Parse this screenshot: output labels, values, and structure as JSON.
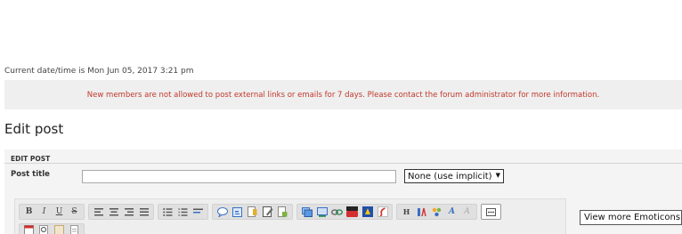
{
  "header": {
    "datetime": "Current date/time is Mon Jun 05, 2017 3:21 pm",
    "notice": "New members are not allowed to post external links or emails for 7 days. Please contact the forum administrator for more information."
  },
  "page": {
    "title": "Edit post"
  },
  "panel": {
    "heading": "EDIT POST",
    "post_title_label": "Post title",
    "post_title_value": "",
    "icon_select": {
      "selected": "None (use implicit)"
    }
  },
  "editor": {
    "row1_groups": [
      [
        "bold-icon",
        "italic-icon",
        "underline-icon",
        "strikethrough-icon"
      ],
      [
        "align-left-icon",
        "align-center-icon",
        "align-right-icon",
        "justify-icon"
      ],
      [
        "bullet-list-icon",
        "numbered-list-icon",
        "horizontal-rule-icon"
      ],
      [
        "quote-icon",
        "code-icon",
        "spoiler-icon",
        "hide-icon",
        "table-icon"
      ],
      [
        "image-icon",
        "image-host-icon",
        "link-icon",
        "youtube-icon",
        "dailymotion-icon",
        "flash-icon"
      ],
      [
        "heading-icon",
        "font-family-icon",
        "color-icon",
        "font-size-icon",
        "more-format-icon"
      ],
      [
        "more-icon"
      ]
    ],
    "row2_icons": [
      "date-icon",
      "search-icon",
      "gif-icon",
      "page-icon"
    ]
  },
  "emoticons": {
    "label": "View more Emoticons"
  },
  "colors": {
    "notice_text": "#c0392b",
    "notice_bg": "#efefef",
    "panel_bg": "#f4f4f4"
  }
}
